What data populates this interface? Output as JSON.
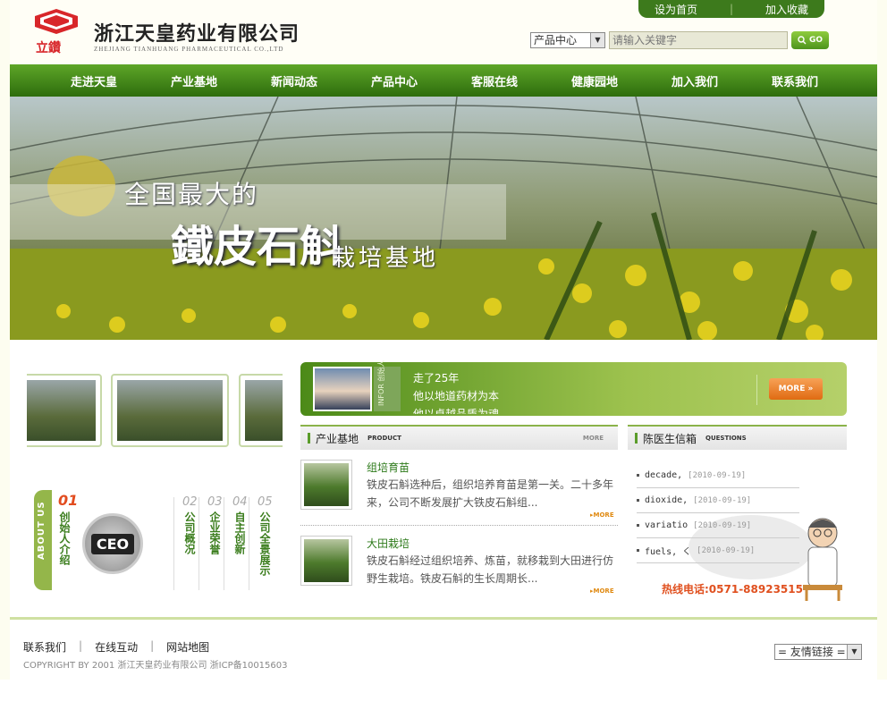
{
  "brand": {
    "mark_text": "立鑽",
    "name_cn": "浙江天皇药业有限公司",
    "name_en": "ZHEJIANG  TIANHUANG PHARMACEUTICAL  CO.,LTD"
  },
  "toplinks": {
    "home": "设为首页",
    "fav": "加入收藏"
  },
  "search": {
    "category": "产品中心",
    "placeholder": "请输入关键字",
    "go": "GO"
  },
  "nav": [
    "走进天皇",
    "产业基地",
    "新闻动态",
    "产品中心",
    "客服在线",
    "健康园地",
    "加入我们",
    "联系我们"
  ],
  "banner": {
    "line1": "全国最大的",
    "line2": "鐵皮石斛",
    "line3": "栽培基地"
  },
  "about": {
    "tab": "ABOUT US",
    "num1": "01",
    "item1": "创始人介绍",
    "ceo": "CEO",
    "num2": "02",
    "item2": "公司概况",
    "num3": "03",
    "item3": "企业荣誉",
    "num4": "04",
    "item4": "自主创新",
    "num5": "05",
    "item5": "公司全景展示"
  },
  "founder": {
    "label": "INFOR 创始人",
    "lines": [
      "走了25年",
      "他以地道药材为本",
      "他以卓越品质为魂"
    ],
    "more": "MORE"
  },
  "product_section": {
    "title": "产业基地",
    "en": "PRODUCT",
    "more": "MORE"
  },
  "products": [
    {
      "title": "组培育苗",
      "desc": "铁皮石斛选种后，组织培养育苗是第一关。二十多年来，公司不断发展扩大铁皮石斛组...",
      "more": "MORE"
    },
    {
      "title": "大田栽培",
      "desc": "铁皮石斛经过组织培养、炼苗，就移栽到大田进行仿野生栽培。铁皮石斛的生长周期长...",
      "more": "MORE"
    }
  ],
  "doctor_section": {
    "title": "陈医生信箱",
    "en": "QUESTIONS"
  },
  "questions": [
    {
      "text": "decade,",
      "date": "[2010-09-19]"
    },
    {
      "text": "dioxide,",
      "date": "[2010-09-19]"
    },
    {
      "text": "variatio",
      "date": "[2010-09-19]"
    },
    {
      "text": "fuels, く",
      "date": "[2010-09-19]"
    }
  ],
  "hotline": "热线电话:0571-88923515",
  "footer": {
    "links": [
      "联系我们",
      "在线互动",
      "网站地图"
    ],
    "copyright": "COPYRIGHT BY 2001 浙江天皇药业有限公司 浙ICP备10015603",
    "friend_links": "= 友情链接 ="
  },
  "colors": {
    "nav_green": "#3d7a1c",
    "accent_orange": "#e06b12",
    "hotline_red": "#e0501f"
  }
}
